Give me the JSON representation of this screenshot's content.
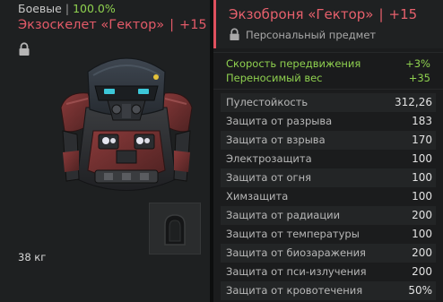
{
  "left": {
    "category": "Боевые",
    "separator": "|",
    "condition": "100.0%",
    "item_name": "Экзоскелет «Гектор»",
    "item_level": "+15",
    "weight": "38 кг",
    "item_icon": "armored-exoskeleton-image",
    "slot_icon": "container-slot-icon"
  },
  "right": {
    "item_name": "Экзоброня «Гектор»",
    "separator": "|",
    "item_level": "+15",
    "personal_label": "Персональный предмет",
    "bonuses": [
      {
        "label": "Скорость передвижения",
        "value": "+3%"
      },
      {
        "label": "Переносимый вес",
        "value": "+35"
      }
    ],
    "stats": [
      {
        "label": "Пулестойкость",
        "value": "312,26"
      },
      {
        "label": "Защита от разрыва",
        "value": "183"
      },
      {
        "label": "Защита от взрыва",
        "value": "170"
      },
      {
        "label": "Электрозащита",
        "value": "100"
      },
      {
        "label": "Защита от огня",
        "value": "100"
      },
      {
        "label": "Химзащита",
        "value": "100"
      },
      {
        "label": "Защита от радиации",
        "value": "200"
      },
      {
        "label": "Защита от температуры",
        "value": "100"
      },
      {
        "label": "Защита от биозаражения",
        "value": "200"
      },
      {
        "label": "Защита от пси-излучения",
        "value": "200"
      },
      {
        "label": "Защита от кровотечения",
        "value": "50%"
      }
    ]
  },
  "colors": {
    "accent_red": "#e25a68",
    "bonus_green": "#8fd14f",
    "condition_green": "#8fd14f"
  }
}
